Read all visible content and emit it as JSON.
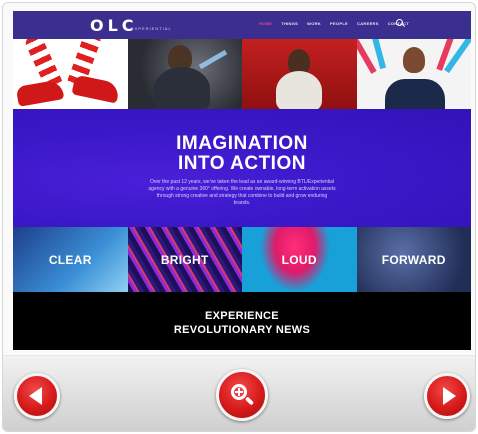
{
  "site": {
    "logo": "OLC",
    "logo_sub": "EXPERIENTIAL",
    "nav": [
      "HOME",
      "THINGS",
      "WORK",
      "PEOPLE",
      "CAREERS",
      "CONTACT"
    ],
    "search_icon": "search-icon"
  },
  "hero": {
    "title_line1": "IMAGINATION",
    "title_line2": "INTO ACTION",
    "copy": "Over the past 12 years, we've taken the lead as an award-winning BTL/Experiential agency with a genuine 360° offering. We create ownable, long-term activation assets through strong creative and strategy that combine to build and grow enduring brands."
  },
  "tiles": [
    "CLEAR",
    "BRIGHT",
    "LOUD",
    "FORWARD"
  ],
  "news": {
    "line1": "EXPERIENCE",
    "line2": "REVOLUTIONARY NEWS"
  },
  "controls": {
    "prev_icon": "arrow-left-icon",
    "zoom_icon": "zoom-in-icon",
    "next_icon": "arrow-right-icon"
  },
  "colors": {
    "header_bg": "#3a2e8e",
    "hero_bg": "#3b19c9",
    "control_red": "#d71a1a",
    "nav_active": "#ff3f8e"
  }
}
